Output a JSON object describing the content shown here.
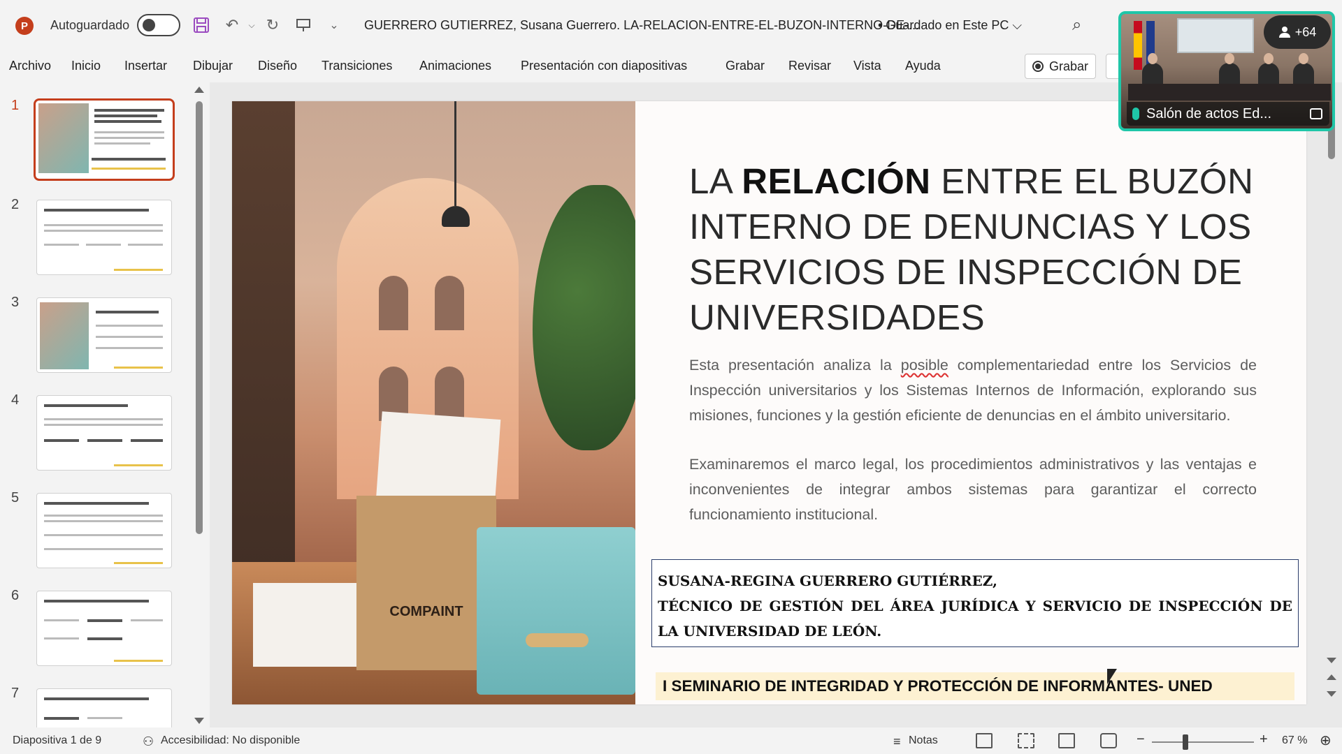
{
  "titlebar": {
    "autosave_label": "Autoguardado",
    "doc_title": "GUERRERO GUTIERREZ, Susana Guerrero. LA-RELACION-ENTRE-EL-BUZON-INTERNO-DE-...",
    "save_state": "•  Guardado en Este PC ⌵"
  },
  "menu": {
    "items": [
      "Archivo",
      "Inicio",
      "Insertar",
      "Dibujar",
      "Diseño",
      "Transiciones",
      "Animaciones",
      "Presentación con diapositivas",
      "Grabar",
      "Revisar",
      "Vista",
      "Ayuda"
    ],
    "record_label": "Grabar"
  },
  "video": {
    "participants": "+64",
    "caption": "Salón de actos Ed..."
  },
  "thumbnails": {
    "numbers": [
      "1",
      "2",
      "3",
      "4",
      "5",
      "6",
      "7"
    ]
  },
  "slide": {
    "title_prefix": "LA ",
    "title_bold": "RELACIÓN",
    "title_rest": " ENTRE EL BUZÓN INTERNO DE DENUNCIAS Y LOS SERVICIOS DE INSPECCIÓN DE UNIVERSIDADES",
    "para1_a": "Esta presentación analiza la ",
    "para1_spell": "posible",
    "para1_b": " complementariedad entre los Servicios de Inspección universitarios y los Sistemas Internos de Información, explorando sus misiones, funciones y la gestión eficiente de denuncias en el ámbito universitario.",
    "para2": "Examinaremos el marco legal, los procedimientos administrativos y las ventajas e inconvenientes de integrar ambos sistemas para garantizar el correcto funcionamiento institucional.",
    "author_line1": "SUSANA-REGINA GUERRERO GUTIÉRREZ,",
    "author_line2": "TÉCNICO DE GESTIÓN DEL ÁREA JURÍDICA Y SERVICIO DE INSPECCIÓN DE LA UNIVERSIDAD DE LEÓN.",
    "seminar": "I SEMINARIO DE INTEGRIDAD Y PROTECCIÓN DE INFORMANTES- UNED",
    "image_label": "COMPAINT"
  },
  "status": {
    "slide_counter": "Diapositiva 1 de 9",
    "accessibility": "Accesibilidad: No disponible",
    "notes": "Notas",
    "zoom": "67 %"
  },
  "colors": {
    "accent": "#c43e1c",
    "video_border": "#1fc6a8",
    "author_border": "#2a3d6b",
    "seminar_bg": "#fdf1d2"
  }
}
